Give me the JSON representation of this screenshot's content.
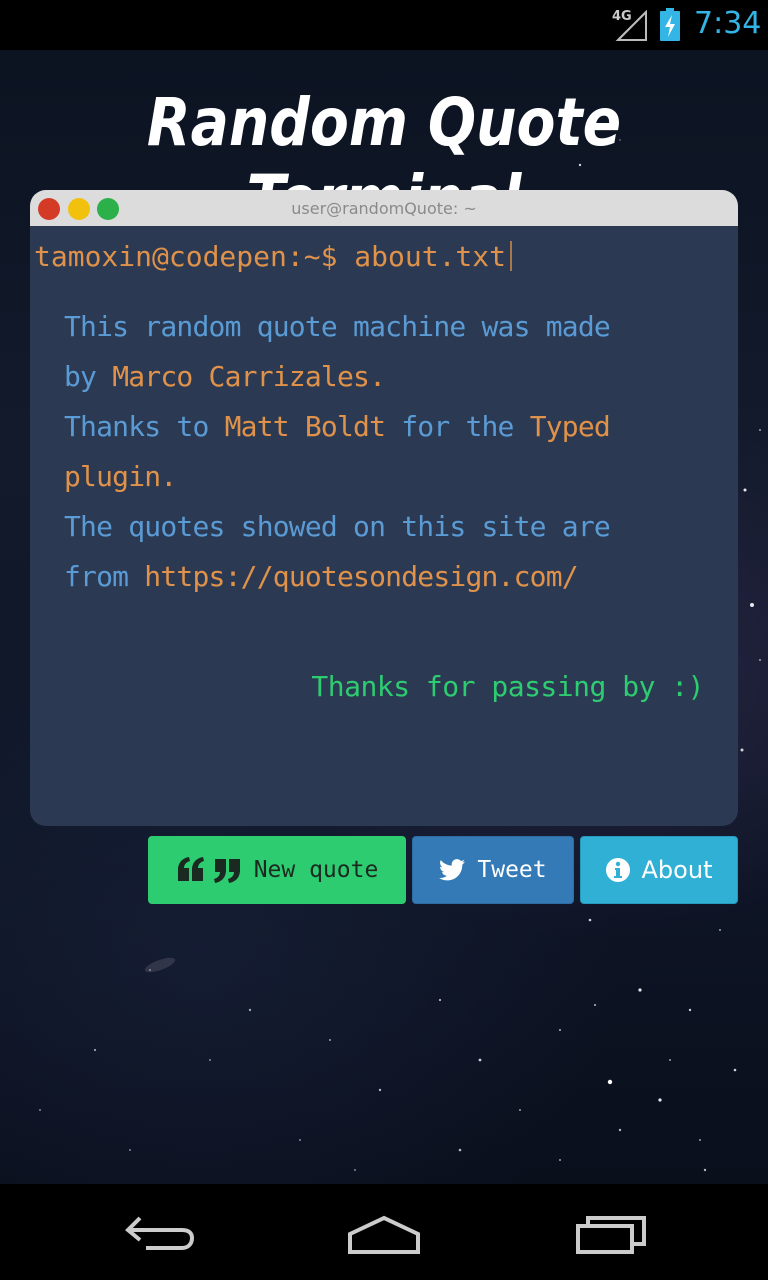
{
  "status_bar": {
    "network": "4G",
    "time": "7:34",
    "icons": [
      "signal-icon",
      "battery-charging-icon"
    ]
  },
  "page": {
    "title": "Random Quote Terminal"
  },
  "terminal": {
    "window_title": "user@randomQuote: ~",
    "prompt": "tamoxin@codepen:~$ about.txt",
    "about_lines": [
      {
        "plain": "This random quote machine was made",
        "hl": ""
      },
      {
        "plain": "by ",
        "hl": "Marco Carrizales."
      },
      {
        "plain": "Thanks to ",
        "hl": "Matt Boldt",
        "plain2": " for the ",
        "hl2": "Typed"
      },
      {
        "plain": "",
        "hl": "plugin."
      },
      {
        "plain": "The quotes showed on this site are",
        "hl": ""
      },
      {
        "plain": "from ",
        "hl": "https://quotesondesign.com/"
      }
    ],
    "farewell": "Thanks for passing by :)"
  },
  "buttons": {
    "new_quote": "New quote",
    "tweet": "Tweet",
    "about": "About"
  },
  "colors": {
    "terminal_bg": "#2b3a52",
    "text_blue": "#5b9bd5",
    "text_orange": "#e0924a",
    "text_green": "#2ecc71",
    "btn_green": "#2ecc71",
    "btn_blue": "#337ab7",
    "btn_cyan": "#31b0d5",
    "status_accent": "#33b5e5"
  },
  "nav_bar": {
    "icons": [
      "back-icon",
      "home-icon",
      "recent-apps-icon"
    ]
  }
}
